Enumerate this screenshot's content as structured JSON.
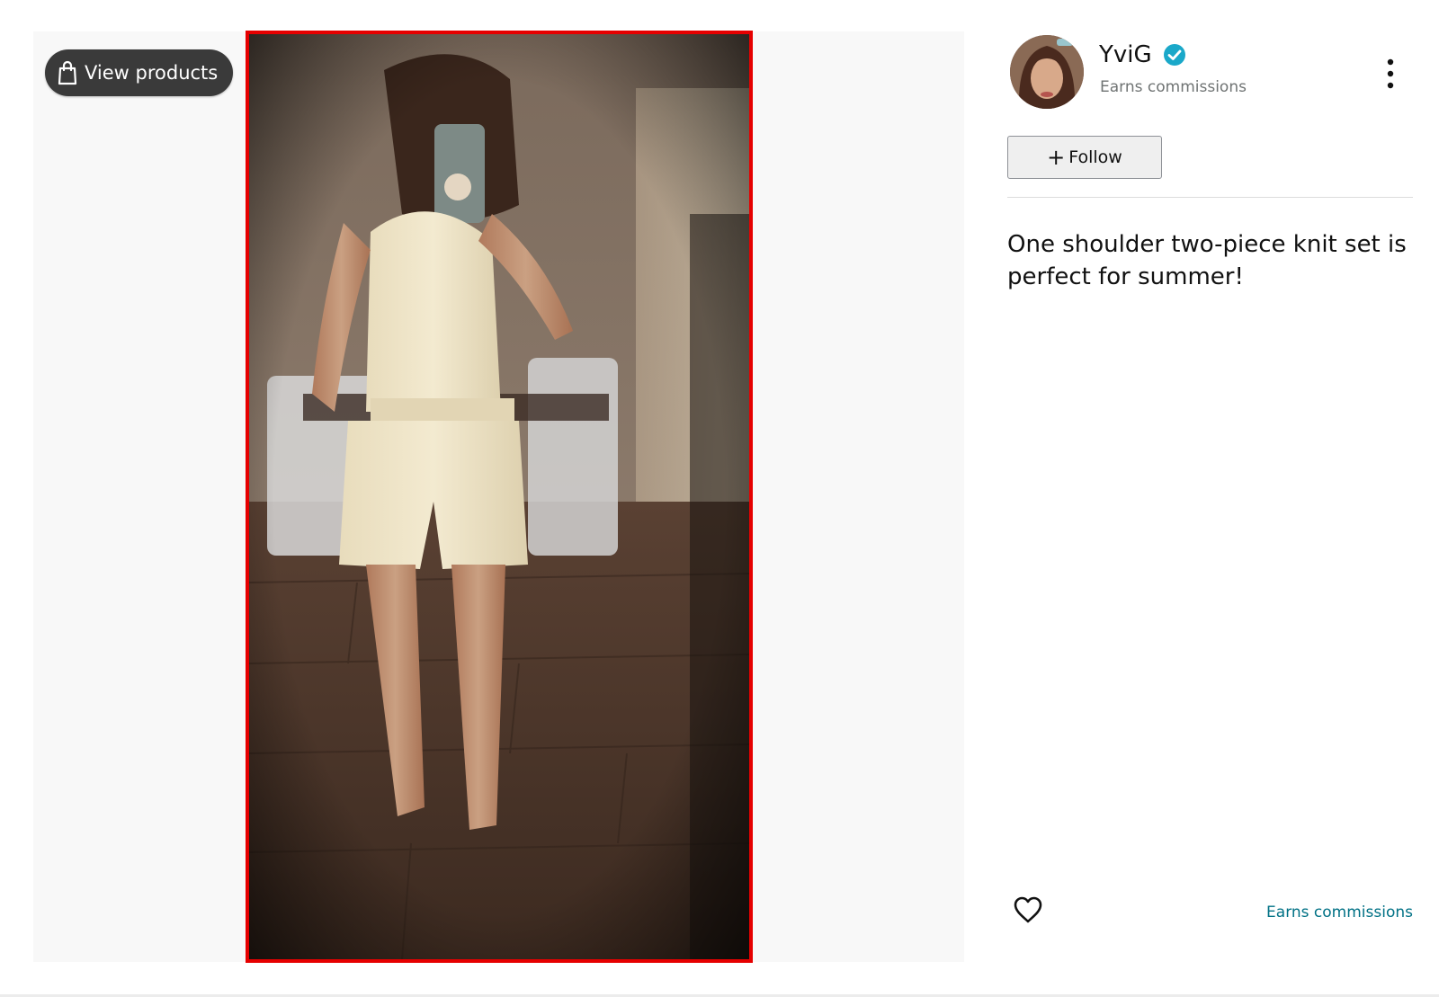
{
  "media": {
    "view_products_label": "View products",
    "photo_alt": "Woman taking a mirror selfie in a one shoulder cream ribbed knit top and shorts set"
  },
  "author": {
    "name": "YviG",
    "subtitle": "Earns commissions",
    "verified": true
  },
  "actions": {
    "follow_label": "Follow",
    "follow_icon": "+"
  },
  "post": {
    "caption": "One shoulder two-piece knit set is perfect for summer!"
  },
  "footer": {
    "earns_link": "Earns commissions"
  },
  "colors": {
    "accent_border": "#e60000",
    "link": "#007185",
    "verified_badge": "#1aa8c9",
    "pill_bg": "#3a3a3a"
  },
  "icons": [
    "shopping-bag-icon",
    "verified-check-icon",
    "more-vertical-icon",
    "plus-icon",
    "heart-icon"
  ]
}
